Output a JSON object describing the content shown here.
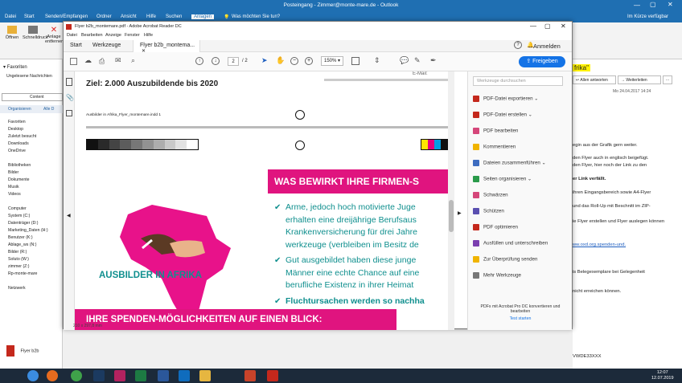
{
  "outlook": {
    "title": "Posteingang - Zimmer@monte-mare.de - Outlook",
    "tabs": [
      "Datei",
      "Start",
      "Senden/Empfangen",
      "Ordner",
      "Ansicht",
      "Hilfe",
      "Suchen",
      "Anlagen"
    ],
    "search_placeholder": "Was möchten Sie tun?",
    "right_flag": "Im Kürze verfügbar",
    "ribbon": {
      "open": "Öffnen",
      "quick_print": "Schnelldruck",
      "attachment": "Anlage entfernen"
    },
    "favorites": "Favoriten",
    "unread": "Ungelesene Nachrichten",
    "explorer": {
      "organize": "Organisieren",
      "all": "Alle D",
      "content": "Content",
      "tree": [
        "Favoriten",
        "Desktop",
        "Zuletzt besucht",
        "Downloads",
        "OneDrive",
        "",
        "Bibliotheken",
        "Bilder",
        "Dokumente",
        "Musik",
        "Videos",
        "",
        "Computer",
        "System (C:)",
        "Datenträger (D:)",
        "Marketing_Daten (H:)",
        "Benutzer (K:)",
        "Ablage_ws (N:)",
        "Bilder (R:)",
        "Soluto (W:)",
        "zimmer (Z:)",
        "Rp-monte-mare",
        "",
        "Netzwerk"
      ]
    },
    "attachment_file": "Flyer b2b",
    "right_pane": {
      "banner": "frika\"",
      "buttons": [
        "Allen antworten",
        "Weiterleiten"
      ],
      "date": "Mo 24.04.2017 14:24",
      "lines": [
        "egin aus der Grafik gern weiter.",
        "den Flyer auch in englisch beigefügt.",
        "den Flyer, hier noch der Link zu den",
        "er Link verfällt.",
        "ihren Eingangsbereich sowie A4-Flyer",
        "und das Roll-Up mit Beschnitt im ZIP-",
        "ie Flyer erstellen und Flyer auslegen können",
        "ww.oxd.org.spenden-und.",
        "is Belegexemplare bei Gelegenheit",
        "nicht erreichen können."
      ],
      "code": "VWDE33XXX"
    }
  },
  "acrobat": {
    "title": "Flyer b2b_montemare.pdf - Adobe Acrobat Reader DC",
    "menu": [
      "Datei",
      "Bearbeiten",
      "Anzeige",
      "Fenster",
      "Hilfe"
    ],
    "tabs": [
      "Start",
      "Werkzeuge",
      "Flyer b2b_montema..."
    ],
    "sign_in": "Anmelden",
    "share": "Freigeben",
    "page_current": "2",
    "page_total": "/ 2",
    "zoom": "150%",
    "search_placeholder": "Werkzeuge durchsuchen",
    "tools": [
      "PDF-Datei exportieren",
      "PDF-Datei erstellen",
      "PDF bearbeiten",
      "Kommentieren",
      "Dateien zusammenführen",
      "Seiten organisieren",
      "Schwärzen",
      "Schützen",
      "PDF optimieren",
      "Ausfüllen und unterschreiben",
      "Zur Überprüfung senden",
      "Mehr Werkzeuge"
    ],
    "promo": "PDFs mit Acrobat Pro DC konvertieren und bearbeiten",
    "promo_link": "Test starten"
  },
  "document": {
    "goal": "Ziel: 2.000 Auszubildende bis 2020",
    "meta": "Ausbilder in Afrika_Flyer_montemare.indd   1",
    "web_partial": "E-Mail:",
    "heading": "WAS BEWIRKT IHRE FIRMEN-S",
    "logo_text": "AUSBILDER IN AFRIKA",
    "bullets": [
      {
        "lines": [
          "Arme, jedoch hoch motivierte Juge",
          "erhalten eine dreijährige Berufsaus"
        ],
        "black": [
          "Krankenversicherung für drei Jahre",
          "werkzeuge (verbleiben im Besitz de"
        ]
      },
      {
        "lines": [
          "Gut ausgebildet haben diese junge",
          "Männer eine echte Chance auf eine",
          "berufliche Existenz in ihrer Heimat"
        ],
        "black": []
      },
      {
        "lines": [],
        "black": [
          "Fluchtursachen werden so nachha"
        ]
      }
    ],
    "footer_banner": "IHRE SPENDEN-MÖGLICHKEITEN AUF EINEN BLICK:",
    "page_size": "210 x 297,8 mm",
    "colors": {
      "magenta": "#e0147f",
      "teal": "#0f8f8e",
      "pink": "#e8128a"
    }
  },
  "taskbar": {
    "time": "12:07",
    "date": "12.07.2019"
  }
}
